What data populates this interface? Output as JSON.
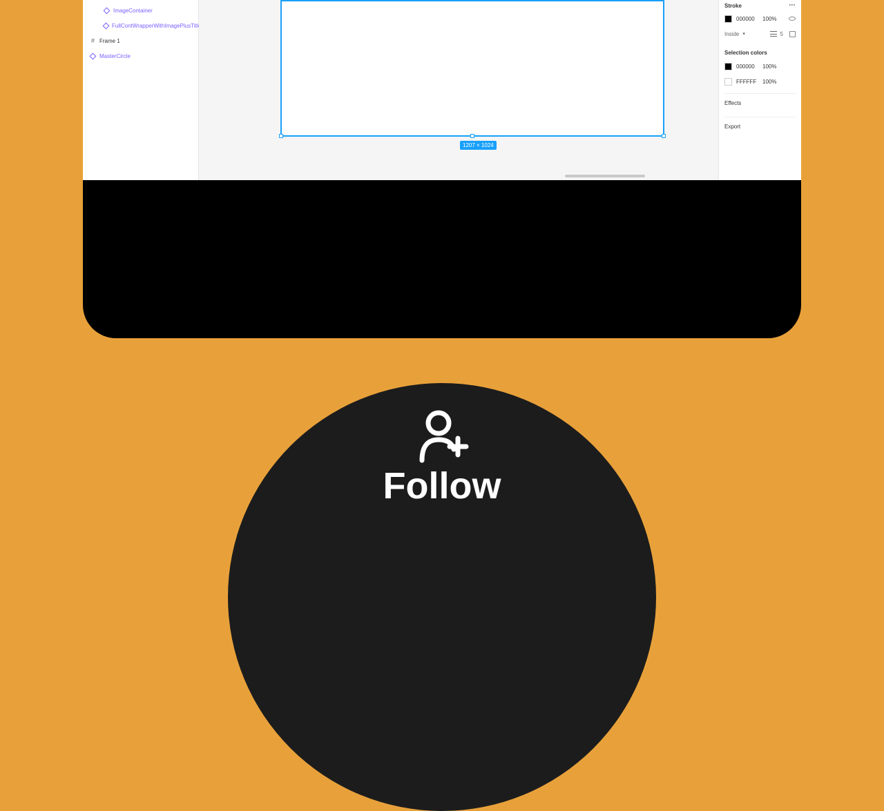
{
  "left_panel": {
    "layers": {
      "image_container": "ImageContainer",
      "full_wrapper": "FullContWrapperWithImagePlusTitle",
      "frame1": "Frame 1",
      "master_circle": "MasterCircle"
    }
  },
  "canvas": {
    "selection_dims": "1207 × 1024"
  },
  "right_panel": {
    "stroke": {
      "header": "Stroke",
      "hex": "000000",
      "opacity": "100%",
      "position": "Inside",
      "weight": "5"
    },
    "selection_colors": {
      "header": "Selection colors",
      "rows": [
        {
          "hex": "000000",
          "opacity": "100%"
        },
        {
          "hex": "FFFFFF",
          "opacity": "100%"
        }
      ]
    },
    "effects": "Effects",
    "export": "Export"
  },
  "follow": {
    "label": "Follow"
  }
}
